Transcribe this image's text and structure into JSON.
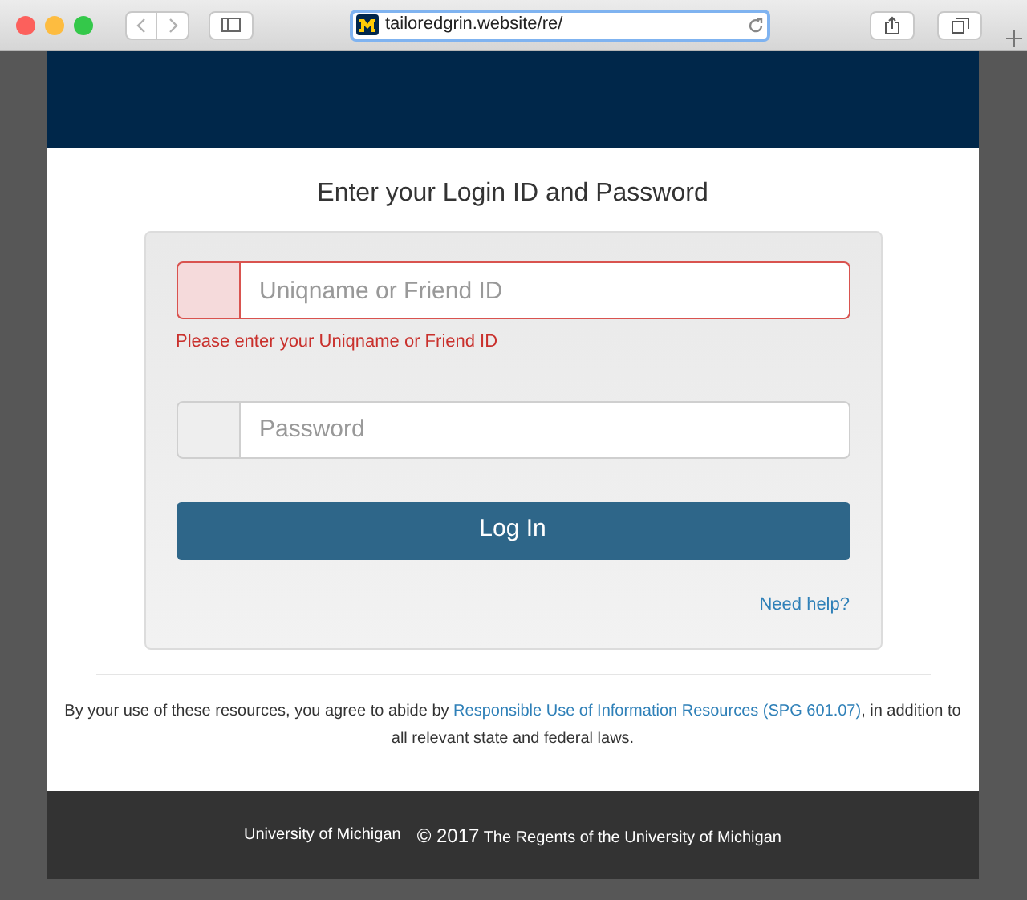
{
  "browser": {
    "url": "tailoredgrin.website/re/"
  },
  "login": {
    "title": "Enter your Login ID and Password",
    "fields": [
      {
        "placeholder": "Uniqname or Friend ID",
        "invalid": true,
        "error": "Please enter your Uniqname or Friend ID"
      },
      {
        "placeholder": "Password",
        "invalid": false
      }
    ],
    "button": "Log In",
    "help_link": "Need help?"
  },
  "notice": {
    "before": "By your use of these resources, you agree to abide by",
    "link": "Responsible Use of Information Resources (SPG 601.07)",
    "after": ", in addition to all relevant state and federal laws."
  },
  "footer": {
    "name": "University of Michigan",
    "copyright": "© 2017",
    "owner": "The Regents of the University of Michigan"
  }
}
